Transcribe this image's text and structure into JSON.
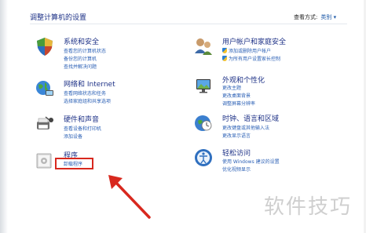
{
  "header": {
    "title": "调整计算机的设置",
    "view_by_label": "查看方式:",
    "view_by_value": "类别 ▾"
  },
  "categories": [
    {
      "title": "系统和安全",
      "links": [
        "查看您的计算机状态",
        "备份您的计算机",
        "查找并解决问题"
      ]
    },
    {
      "title": "网络和 Internet",
      "links": [
        "查看网络状态和任务",
        "选择家庭组和共享选项"
      ]
    },
    {
      "title": "硬件和声音",
      "links": [
        "查看设备和打印机",
        "添加设备"
      ]
    },
    {
      "title": "程序",
      "links": [
        "卸载程序"
      ]
    },
    {
      "title": "用户帐户和家庭安全",
      "links": [
        "添加或删除用户帐户",
        "为所有用户设置家长控制"
      ]
    },
    {
      "title": "外观和个性化",
      "links": [
        "更改主题",
        "更改桌面背景",
        "调整屏幕分辨率"
      ]
    },
    {
      "title": "时钟、语言和区域",
      "links": [
        "更改键盘或其他输入法",
        "更改显示语言"
      ]
    },
    {
      "title": "轻松访问",
      "links": [
        "使用 Windows 建议的设置",
        "优化视频显示"
      ]
    }
  ],
  "watermark": "软件技巧",
  "colors": {
    "title": "#1e3287",
    "link": "#2a5fb5",
    "highlight": "#d8281e",
    "arrow": "#d8281e"
  },
  "icons": [
    "system-security-icon",
    "network-icon",
    "hardware-sound-icon",
    "programs-icon",
    "user-accounts-icon",
    "appearance-icon",
    "clock-language-icon",
    "ease-of-access-icon"
  ]
}
